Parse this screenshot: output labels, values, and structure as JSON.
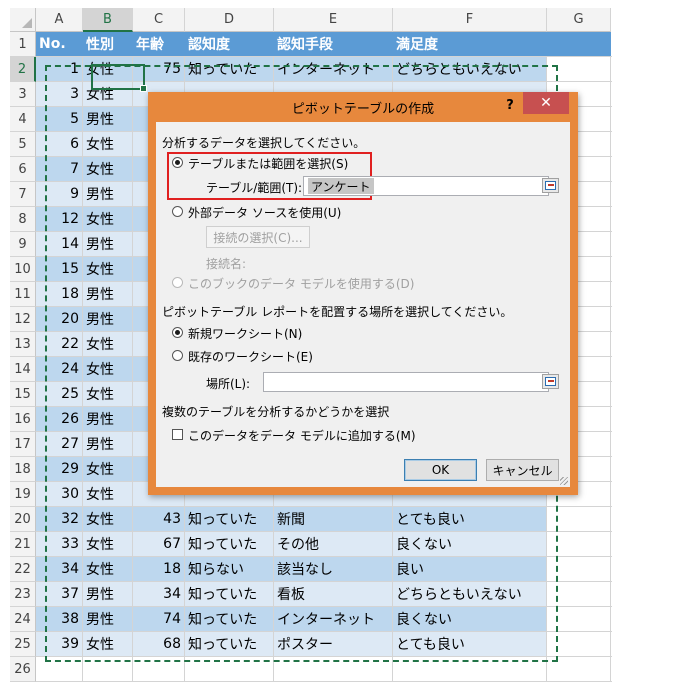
{
  "sheet": {
    "columns": [
      "A",
      "B",
      "C",
      "D",
      "E",
      "F",
      "G"
    ],
    "selected_column": "B",
    "selected_row": "2",
    "header_row": {
      "row": "1",
      "cells": [
        "No.",
        "性別",
        "年齢",
        "認知度",
        "認知手段",
        "満足度"
      ]
    },
    "rows": [
      {
        "row": "2",
        "cells": [
          "1",
          "女性",
          "75",
          "知っていた",
          "インターネット",
          "どちらともいえない"
        ]
      },
      {
        "row": "3",
        "cells": [
          "3",
          "女性",
          "",
          "",
          "",
          ""
        ]
      },
      {
        "row": "4",
        "cells": [
          "5",
          "男性",
          "",
          "",
          "",
          ""
        ]
      },
      {
        "row": "5",
        "cells": [
          "6",
          "女性",
          "",
          "",
          "",
          ""
        ]
      },
      {
        "row": "6",
        "cells": [
          "7",
          "女性",
          "",
          "",
          "",
          ""
        ]
      },
      {
        "row": "7",
        "cells": [
          "9",
          "男性",
          "",
          "",
          "",
          ""
        ]
      },
      {
        "row": "8",
        "cells": [
          "12",
          "女性",
          "",
          "",
          "",
          ""
        ]
      },
      {
        "row": "9",
        "cells": [
          "14",
          "男性",
          "",
          "",
          "",
          ""
        ]
      },
      {
        "row": "10",
        "cells": [
          "15",
          "女性",
          "",
          "",
          "",
          ""
        ]
      },
      {
        "row": "11",
        "cells": [
          "18",
          "男性",
          "",
          "",
          "",
          ""
        ]
      },
      {
        "row": "12",
        "cells": [
          "20",
          "男性",
          "",
          "",
          "",
          ""
        ]
      },
      {
        "row": "13",
        "cells": [
          "22",
          "女性",
          "",
          "",
          "",
          ""
        ]
      },
      {
        "row": "14",
        "cells": [
          "24",
          "女性",
          "",
          "",
          "",
          ""
        ]
      },
      {
        "row": "15",
        "cells": [
          "25",
          "女性",
          "",
          "",
          "",
          ""
        ]
      },
      {
        "row": "16",
        "cells": [
          "26",
          "男性",
          "",
          "",
          "",
          ""
        ]
      },
      {
        "row": "17",
        "cells": [
          "27",
          "男性",
          "",
          "",
          "",
          ""
        ]
      },
      {
        "row": "18",
        "cells": [
          "29",
          "女性",
          "",
          "",
          "",
          ""
        ]
      },
      {
        "row": "19",
        "cells": [
          "30",
          "女性",
          "",
          "",
          "",
          ""
        ]
      },
      {
        "row": "20",
        "cells": [
          "32",
          "女性",
          "43",
          "知っていた",
          "新聞",
          "とても良い"
        ]
      },
      {
        "row": "21",
        "cells": [
          "33",
          "女性",
          "67",
          "知っていた",
          "その他",
          "良くない"
        ]
      },
      {
        "row": "22",
        "cells": [
          "34",
          "女性",
          "18",
          "知らない",
          "該当なし",
          "良い"
        ]
      },
      {
        "row": "23",
        "cells": [
          "37",
          "男性",
          "34",
          "知っていた",
          "看板",
          "どちらともいえない"
        ]
      },
      {
        "row": "24",
        "cells": [
          "38",
          "男性",
          "74",
          "知っていた",
          "インターネット",
          "良くない"
        ]
      },
      {
        "row": "25",
        "cells": [
          "39",
          "女性",
          "68",
          "知っていた",
          "ポスター",
          "とても良い"
        ]
      }
    ],
    "blank_row": "26"
  },
  "dialog": {
    "title": "ピボットテーブルの作成",
    "help_label": "?",
    "close_label": "✕",
    "section1": "分析するデータを選択してください。",
    "opt_table_range": "テーブルまたは範囲を選択(S)",
    "table_range_label": "テーブル/範囲(T):",
    "table_range_value": "アンケート",
    "opt_external": "外部データ ソースを使用(U)",
    "choose_connection": "接続の選択(C)...",
    "connection_name": "接続名:",
    "opt_data_model": "このブックのデータ モデルを使用する(D)",
    "section2": "ピボットテーブル レポートを配置する場所を選択してください。",
    "opt_new_sheet": "新規ワークシート(N)",
    "opt_existing_sheet": "既存のワークシート(E)",
    "location_label": "場所(L):",
    "location_value": "",
    "section3": "複数のテーブルを分析するかどうかを選択",
    "add_to_model": "このデータをデータ モデルに追加する(M)",
    "ok_label": "OK",
    "cancel_label": "キャンセル"
  },
  "colors": {
    "header_fill": "#5b9bd5",
    "band_light": "#dde9f5",
    "band_dark": "#bdd7ee",
    "selection_green": "#217346",
    "dialog_frame": "#e7883d",
    "close_red": "#c75050",
    "highlight_red": "#e02020"
  }
}
